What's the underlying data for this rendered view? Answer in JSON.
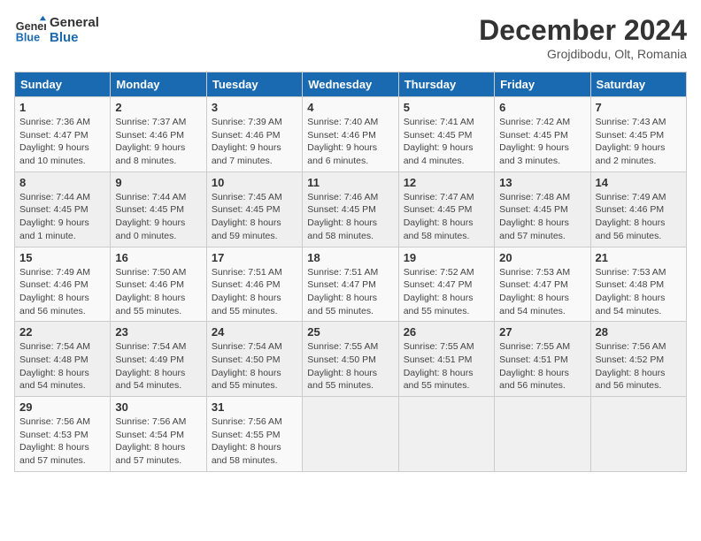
{
  "header": {
    "logo_line1": "General",
    "logo_line2": "Blue",
    "month": "December 2024",
    "location": "Grojdibodu, Olt, Romania"
  },
  "weekdays": [
    "Sunday",
    "Monday",
    "Tuesday",
    "Wednesday",
    "Thursday",
    "Friday",
    "Saturday"
  ],
  "weeks": [
    [
      {
        "day": "1",
        "info": "Sunrise: 7:36 AM\nSunset: 4:47 PM\nDaylight: 9 hours and 10 minutes."
      },
      {
        "day": "2",
        "info": "Sunrise: 7:37 AM\nSunset: 4:46 PM\nDaylight: 9 hours and 8 minutes."
      },
      {
        "day": "3",
        "info": "Sunrise: 7:39 AM\nSunset: 4:46 PM\nDaylight: 9 hours and 7 minutes."
      },
      {
        "day": "4",
        "info": "Sunrise: 7:40 AM\nSunset: 4:46 PM\nDaylight: 9 hours and 6 minutes."
      },
      {
        "day": "5",
        "info": "Sunrise: 7:41 AM\nSunset: 4:45 PM\nDaylight: 9 hours and 4 minutes."
      },
      {
        "day": "6",
        "info": "Sunrise: 7:42 AM\nSunset: 4:45 PM\nDaylight: 9 hours and 3 minutes."
      },
      {
        "day": "7",
        "info": "Sunrise: 7:43 AM\nSunset: 4:45 PM\nDaylight: 9 hours and 2 minutes."
      }
    ],
    [
      {
        "day": "8",
        "info": "Sunrise: 7:44 AM\nSunset: 4:45 PM\nDaylight: 9 hours and 1 minute."
      },
      {
        "day": "9",
        "info": "Sunrise: 7:44 AM\nSunset: 4:45 PM\nDaylight: 9 hours and 0 minutes."
      },
      {
        "day": "10",
        "info": "Sunrise: 7:45 AM\nSunset: 4:45 PM\nDaylight: 8 hours and 59 minutes."
      },
      {
        "day": "11",
        "info": "Sunrise: 7:46 AM\nSunset: 4:45 PM\nDaylight: 8 hours and 58 minutes."
      },
      {
        "day": "12",
        "info": "Sunrise: 7:47 AM\nSunset: 4:45 PM\nDaylight: 8 hours and 58 minutes."
      },
      {
        "day": "13",
        "info": "Sunrise: 7:48 AM\nSunset: 4:45 PM\nDaylight: 8 hours and 57 minutes."
      },
      {
        "day": "14",
        "info": "Sunrise: 7:49 AM\nSunset: 4:46 PM\nDaylight: 8 hours and 56 minutes."
      }
    ],
    [
      {
        "day": "15",
        "info": "Sunrise: 7:49 AM\nSunset: 4:46 PM\nDaylight: 8 hours and 56 minutes."
      },
      {
        "day": "16",
        "info": "Sunrise: 7:50 AM\nSunset: 4:46 PM\nDaylight: 8 hours and 55 minutes."
      },
      {
        "day": "17",
        "info": "Sunrise: 7:51 AM\nSunset: 4:46 PM\nDaylight: 8 hours and 55 minutes."
      },
      {
        "day": "18",
        "info": "Sunrise: 7:51 AM\nSunset: 4:47 PM\nDaylight: 8 hours and 55 minutes."
      },
      {
        "day": "19",
        "info": "Sunrise: 7:52 AM\nSunset: 4:47 PM\nDaylight: 8 hours and 55 minutes."
      },
      {
        "day": "20",
        "info": "Sunrise: 7:53 AM\nSunset: 4:47 PM\nDaylight: 8 hours and 54 minutes."
      },
      {
        "day": "21",
        "info": "Sunrise: 7:53 AM\nSunset: 4:48 PM\nDaylight: 8 hours and 54 minutes."
      }
    ],
    [
      {
        "day": "22",
        "info": "Sunrise: 7:54 AM\nSunset: 4:48 PM\nDaylight: 8 hours and 54 minutes."
      },
      {
        "day": "23",
        "info": "Sunrise: 7:54 AM\nSunset: 4:49 PM\nDaylight: 8 hours and 54 minutes."
      },
      {
        "day": "24",
        "info": "Sunrise: 7:54 AM\nSunset: 4:50 PM\nDaylight: 8 hours and 55 minutes."
      },
      {
        "day": "25",
        "info": "Sunrise: 7:55 AM\nSunset: 4:50 PM\nDaylight: 8 hours and 55 minutes."
      },
      {
        "day": "26",
        "info": "Sunrise: 7:55 AM\nSunset: 4:51 PM\nDaylight: 8 hours and 55 minutes."
      },
      {
        "day": "27",
        "info": "Sunrise: 7:55 AM\nSunset: 4:51 PM\nDaylight: 8 hours and 56 minutes."
      },
      {
        "day": "28",
        "info": "Sunrise: 7:56 AM\nSunset: 4:52 PM\nDaylight: 8 hours and 56 minutes."
      }
    ],
    [
      {
        "day": "29",
        "info": "Sunrise: 7:56 AM\nSunset: 4:53 PM\nDaylight: 8 hours and 57 minutes."
      },
      {
        "day": "30",
        "info": "Sunrise: 7:56 AM\nSunset: 4:54 PM\nDaylight: 8 hours and 57 minutes."
      },
      {
        "day": "31",
        "info": "Sunrise: 7:56 AM\nSunset: 4:55 PM\nDaylight: 8 hours and 58 minutes."
      },
      null,
      null,
      null,
      null
    ]
  ]
}
